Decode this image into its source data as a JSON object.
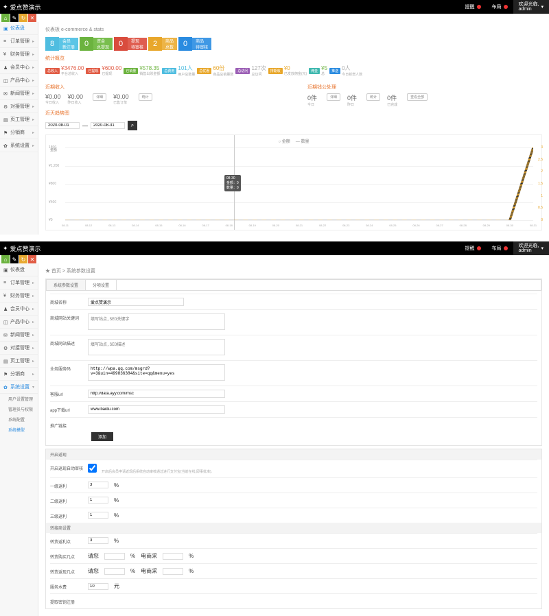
{
  "brand": "爱点赞演示",
  "topbar": {
    "notify": "提醒",
    "logout": "布局",
    "user_line1": "欢迎光临,",
    "user_line2": "admin"
  },
  "sidebar": {
    "items": [
      {
        "label": "仪表盘"
      },
      {
        "label": "订单管理"
      },
      {
        "label": "财务管理"
      },
      {
        "label": "会员中心"
      },
      {
        "label": "产品中心"
      },
      {
        "label": "新闻管理"
      },
      {
        "label": "对接管理"
      },
      {
        "label": "页工管理"
      },
      {
        "label": "分销商"
      },
      {
        "label": "系统设置"
      }
    ],
    "sub": [
      {
        "label": "用户设置管理"
      },
      {
        "label": "管理员与权限"
      },
      {
        "label": "系统配置"
      },
      {
        "label": "系统模型"
      }
    ]
  },
  "crumb1": "仪表板    e-commerce & stats",
  "crumb2": "★ 首页 > 系统参数设置",
  "stat_cards": [
    {
      "n": "8",
      "l1": "会员",
      "l2": "新注册"
    },
    {
      "n": "0",
      "l1": "资金",
      "l2": "总提现"
    },
    {
      "n": "0",
      "l1": "提现",
      "l2": "待审核"
    },
    {
      "n": "2",
      "l1": "商品",
      "l2": "总数"
    },
    {
      "n": "0",
      "l1": "商品",
      "l2": "待审核"
    }
  ],
  "section_stats": "统计概览",
  "metrics": [
    {
      "tag": "总收入",
      "cls": "red",
      "val": "¥3476.00",
      "vcls": "red",
      "sub": "平台总收入"
    },
    {
      "tag": "已提现",
      "cls": "red",
      "val": "¥600.00",
      "vcls": "red",
      "sub": "已提现"
    },
    {
      "tag": "已销量",
      "cls": "green",
      "val": "¥578.35",
      "vcls": "green",
      "sub": "销售出账金额"
    },
    {
      "tag": "总费用",
      "cls": "blue",
      "val": "101人",
      "vcls": "blue",
      "sub": "用户总数量"
    },
    {
      "tag": "总优惠",
      "cls": "orange",
      "val": "60份",
      "vcls": "orange",
      "sub": "商品总销量数"
    },
    {
      "tag": "总访问",
      "cls": "purple",
      "val": "127次",
      "vcls": "grey",
      "sub": "总访问"
    },
    {
      "tag": "排期收",
      "cls": "orange",
      "val": "¥0",
      "vcls": "orange",
      "sub": "已发放佣金(元)"
    },
    {
      "tag": "佣金",
      "cls": "teal",
      "val": "¥5",
      "vcls": "green",
      "sub": "总"
    },
    {
      "tag": "推送",
      "cls": "dblue",
      "val": "0人",
      "vcls": "grey",
      "sub": "今日新增人数"
    }
  ],
  "section_income": "近期收入",
  "section_aftersale": "近期钱公处理",
  "income": [
    {
      "v": "¥0.00",
      "l": "今日收入"
    },
    {
      "v": "¥0.00",
      "l": "昨日收入"
    },
    {
      "v": "¥0.00",
      "l": "已售订单"
    }
  ],
  "income_tags": [
    "详细",
    "统计"
  ],
  "aftersale": [
    {
      "v": "0件",
      "l": "今日"
    },
    {
      "v": "0件",
      "l": "昨日"
    },
    {
      "v": "0件",
      "l": "已完成"
    }
  ],
  "aftersale_tags": [
    "详细",
    "统计",
    "查看全部"
  ],
  "section_chart": "近天趋势图",
  "date_from": "2020-08-01",
  "date_to": "2020-08-31",
  "chart_legend": [
    "金额",
    "数量"
  ],
  "chart_tooltip": {
    "l1": "08-30",
    "l2": "金额：0",
    "l3": "数量：0"
  },
  "chart_data": {
    "type": "line",
    "x": [
      "08-11",
      "08-12",
      "08-13",
      "08-14",
      "08-15",
      "08-16",
      "08-17",
      "08-18",
      "08-19",
      "08-20",
      "08-21",
      "08-22",
      "08-23",
      "08-24",
      "08-25",
      "08-26",
      "08-27",
      "08-28",
      "08-29",
      "08-30",
      "08-31"
    ],
    "series": [
      {
        "name": "金额",
        "values": [
          0,
          0,
          0,
          0,
          0,
          0,
          0,
          0,
          0,
          0,
          0,
          0,
          0,
          0,
          0,
          0,
          0,
          0,
          0,
          0,
          1800
        ]
      },
      {
        "name": "数量",
        "values": [
          0,
          0,
          0,
          0,
          0,
          0,
          0,
          0,
          0,
          0,
          0,
          0,
          0,
          0,
          0,
          0,
          0,
          0,
          0,
          0,
          3
        ]
      }
    ],
    "ylim_left": [
      0,
      1800
    ],
    "ylim_right": [
      0,
      3
    ],
    "yticks_left": [
      "1800",
      "¥1,200",
      "¥800",
      "¥400",
      "¥0"
    ],
    "yticks_right": [
      "3",
      "2.5",
      "2",
      "1.5",
      "1",
      "0.5",
      "0"
    ],
    "xlabel": "",
    "ylabel": "金额"
  },
  "tabs": [
    "系统参数设置",
    "分项设置"
  ],
  "form": {
    "site_name_lbl": "商城名称",
    "site_name_val": "爱点赞演示",
    "seo_kw_lbl": "商城网站关键词",
    "seo_kw_ph": "填写站点,SEO关键字",
    "seo_desc_lbl": "商城网站描述",
    "seo_desc_ph": "填写站点,SEO描述",
    "service_code_lbl": "业务服务码",
    "service_code_val": "http://wpa.qq.com/msgrd?v=3&uin=499836384&site=qq&menu=yes",
    "kefu_lbl": "客服url",
    "kefu_val": "http://data.ayy.com/msc",
    "app_lbl": "app下载url",
    "app_val": "www.baidu.com",
    "tg_lbl": "推广链接",
    "submit": "添加",
    "withdraw_hdr": "开启返现",
    "autopass_lbl": "开启返现自动审核",
    "autopass_hint": "开启后会员申请返现后系统自动审核通过进行支付宝(当前在线,即事批准).",
    "lv1_lbl": "一级返利",
    "lv1_v": "3",
    "pct": "%",
    "lv2_lbl": "二级返利",
    "lv2_v": "1",
    "lv3_lbl": "三级返利",
    "lv3_v": "1",
    "reseller_hdr": "转接商设置",
    "res_def_lbl": "转货返利点",
    "res_def_v": "3",
    "res_buy_lbl": "转货购买几点",
    "res_buy_a_l": "请您",
    "res_buy_a_v": "",
    "res_buy_b_l": "电商采",
    "res_buy_b_v": "",
    "res_get_lbl": "转货返现几点",
    "res_get_a_l": "请您",
    "res_get_a_v": "",
    "res_get_b_l": "电商采",
    "res_get_b_v": "",
    "service_fee_lbl": "服务水费",
    "sf_v": "10",
    "sf_u": "元",
    "reg_sms_lbl": "提取密钥注册"
  }
}
